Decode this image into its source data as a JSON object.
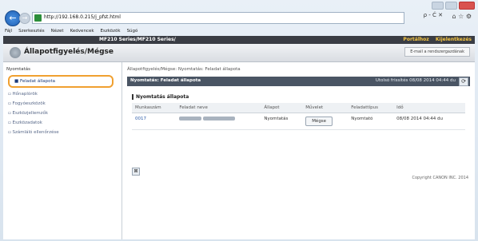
{
  "browser": {
    "url": "http://192.168.0.215/j_pfst.html",
    "addr_tools": "ρ - Ć ✕",
    "right_icons": "⌂ ☆ ⚙",
    "menu": [
      "Fájl",
      "Szerkesztés",
      "Nézet",
      "Kedvencek",
      "Eszközök",
      "Súgó"
    ]
  },
  "printer": {
    "model": "MF210 Series/MF210 Series/",
    "links": [
      "Portálhoz",
      "Kijelentkezés"
    ]
  },
  "header": {
    "title": "Állapotfigyelés/Mégse",
    "mail_button": "E-mail a rendszergazdának"
  },
  "sidebar": {
    "group": "Nyomtatás",
    "items": [
      {
        "label": "Feladat állapota",
        "selected": true
      },
      {
        "label": "Hőnaplórök",
        "selected": false
      },
      {
        "label": "Fogyóeszközök",
        "selected": false
      },
      {
        "label": "Eszközjellemzők",
        "selected": false
      },
      {
        "label": "Eszközadatok",
        "selected": false
      },
      {
        "label": "Számláló ellenőrzése",
        "selected": false
      }
    ]
  },
  "main": {
    "breadcrumb": "Állapotfigyelés/Mégse: Nyomtatás: Feladat állapota",
    "section_title": "Nyomtatás: Feladat állapota",
    "last_update": "Utolsó frissítés 08/08 2014 04:44 du",
    "panel_title": "Nyomtatás állapota",
    "columns": [
      "Munkaszám",
      "Feladat neve",
      "Állapot",
      "Művelet",
      "Feladattípus",
      "Idő"
    ],
    "rows": [
      {
        "job_no": "0017",
        "status": "Nyomtatás",
        "action": "Mégse",
        "type": "Nyomtató",
        "time": "08/08 2014 04:44 du"
      }
    ],
    "copyright": "Copyright CANON INC. 2014"
  }
}
